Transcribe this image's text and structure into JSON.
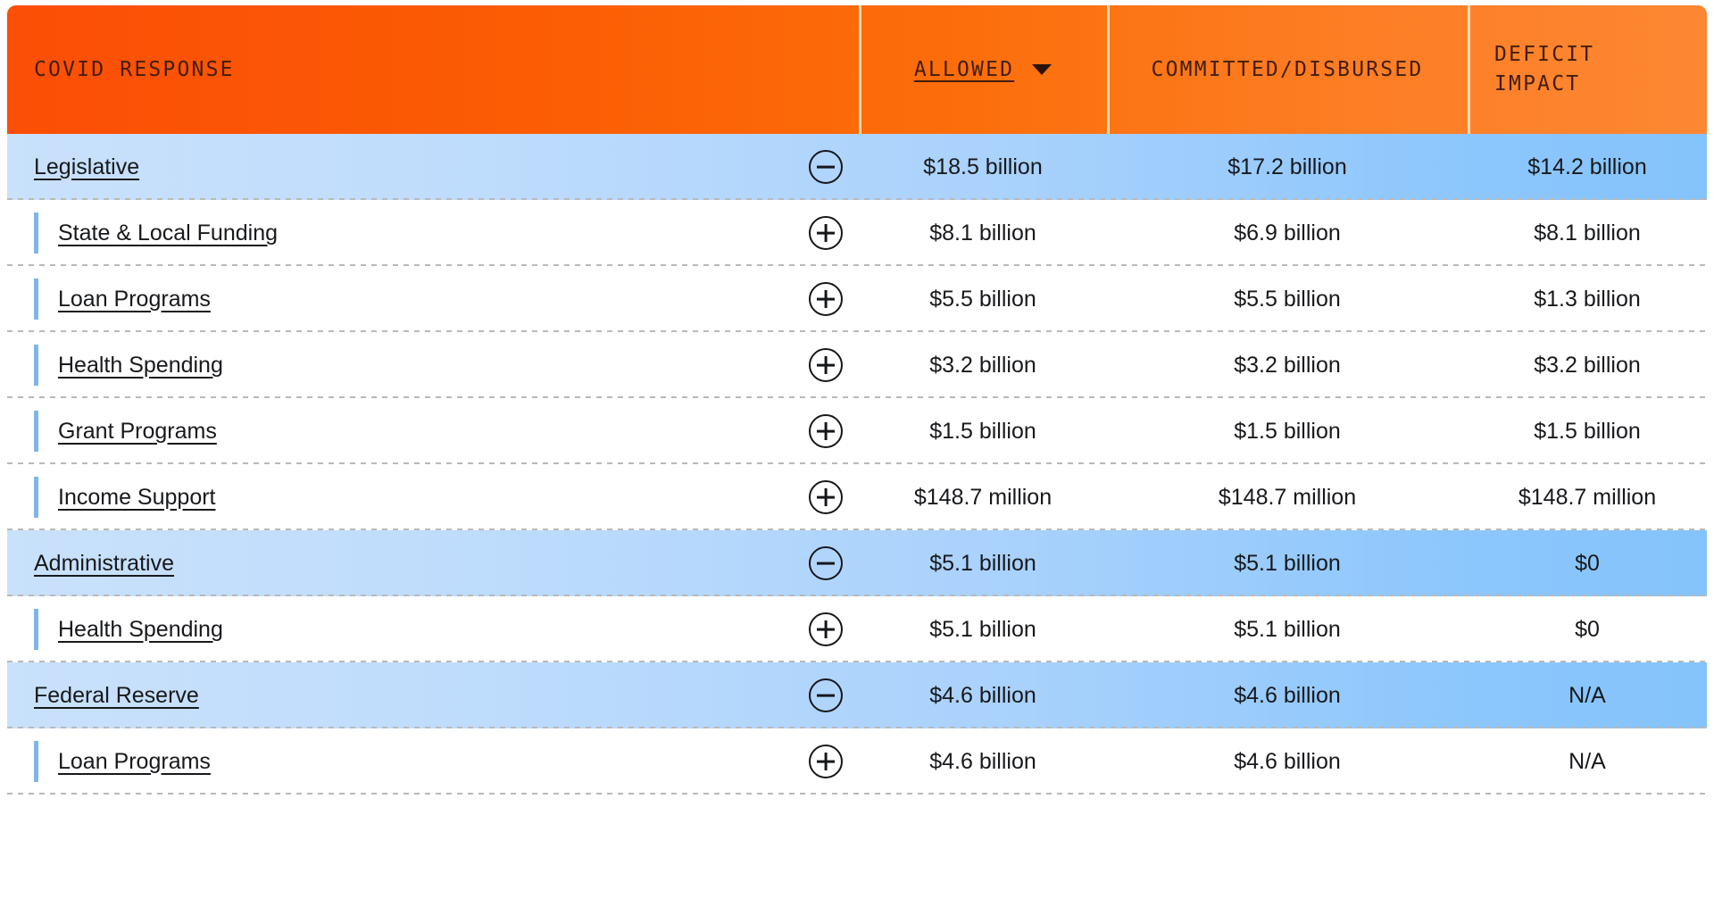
{
  "table": {
    "columns": {
      "name": "COVID RESPONSE",
      "allowed": "ALLOWED",
      "committed": "COMMITTED/DISBURSED",
      "deficit_line1": "DEFICIT",
      "deficit_line2": "IMPACT"
    },
    "sort": {
      "active_column": "ALLOWED",
      "direction": "descending",
      "caret_icon": "chevron-down-icon"
    },
    "colors": {
      "header_orange_start": "#fb4e06",
      "header_orange_end": "#fd8733",
      "parent_blue_start": "#c9e1fb",
      "parent_blue_end": "#84c3fb",
      "indent_bar_blue": "#7fb6e8",
      "text_dark": "#17191c"
    },
    "rows": [
      {
        "label": "Legislative",
        "level": 0,
        "toggle_icon": "circle-minus-icon",
        "expanded": true,
        "allowed": "$18.5 billion",
        "committed": "$17.2 billion",
        "deficit": "$14.2 billion"
      },
      {
        "label": "State & Local Funding",
        "level": 1,
        "toggle_icon": "circle-plus-icon",
        "expanded": false,
        "allowed": "$8.1 billion",
        "committed": "$6.9 billion",
        "deficit": "$8.1 billion"
      },
      {
        "label": "Loan Programs",
        "level": 1,
        "toggle_icon": "circle-plus-icon",
        "expanded": false,
        "allowed": "$5.5 billion",
        "committed": "$5.5 billion",
        "deficit": "$1.3 billion"
      },
      {
        "label": "Health Spending",
        "level": 1,
        "toggle_icon": "circle-plus-icon",
        "expanded": false,
        "allowed": "$3.2 billion",
        "committed": "$3.2 billion",
        "deficit": "$3.2 billion"
      },
      {
        "label": "Grant Programs",
        "level": 1,
        "toggle_icon": "circle-plus-icon",
        "expanded": false,
        "allowed": "$1.5 billion",
        "committed": "$1.5 billion",
        "deficit": "$1.5 billion"
      },
      {
        "label": "Income Support",
        "level": 1,
        "toggle_icon": "circle-plus-icon",
        "expanded": false,
        "allowed": "$148.7 million",
        "committed": "$148.7 million",
        "deficit": "$148.7 million"
      },
      {
        "label": "Administrative",
        "level": 0,
        "toggle_icon": "circle-minus-icon",
        "expanded": true,
        "allowed": "$5.1 billion",
        "committed": "$5.1 billion",
        "deficit": "$0"
      },
      {
        "label": "Health Spending",
        "level": 1,
        "toggle_icon": "circle-plus-icon",
        "expanded": false,
        "allowed": "$5.1 billion",
        "committed": "$5.1 billion",
        "deficit": "$0"
      },
      {
        "label": "Federal Reserve",
        "level": 0,
        "toggle_icon": "circle-minus-icon",
        "expanded": true,
        "allowed": "$4.6 billion",
        "committed": "$4.6 billion",
        "deficit": "N/A"
      },
      {
        "label": "Loan Programs",
        "level": 1,
        "toggle_icon": "circle-plus-icon",
        "expanded": false,
        "allowed": "$4.6 billion",
        "committed": "$4.6 billion",
        "deficit": "N/A"
      }
    ]
  }
}
